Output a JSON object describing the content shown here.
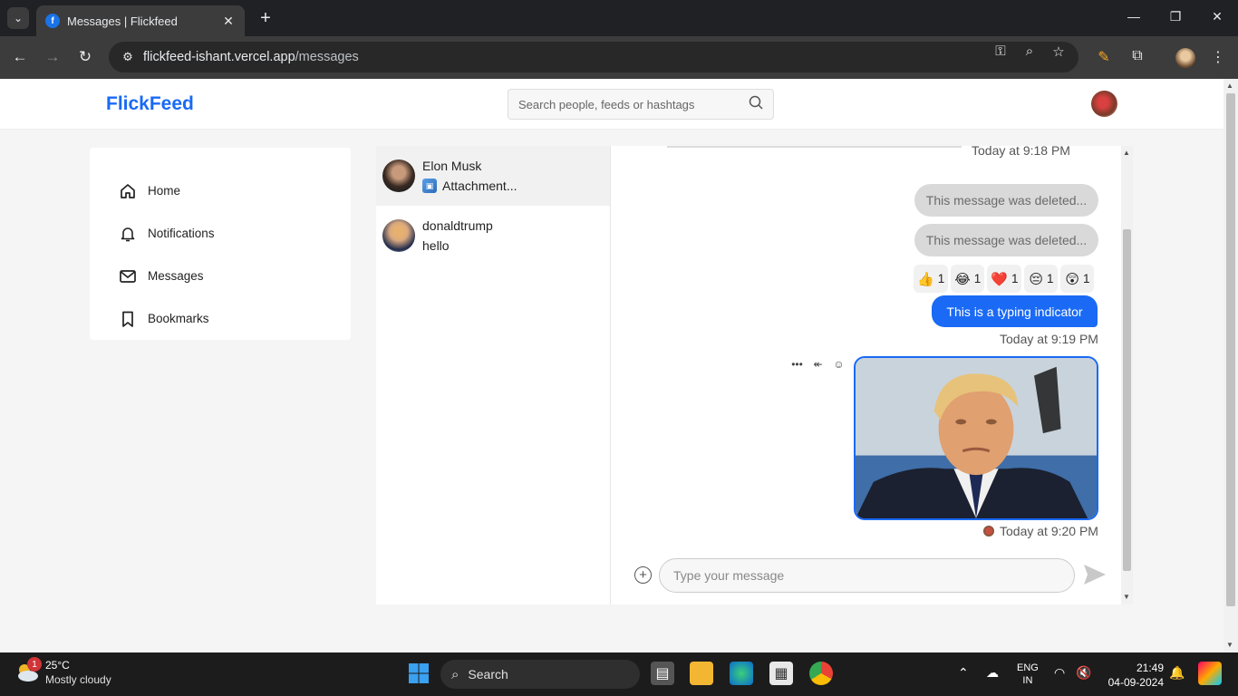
{
  "browser": {
    "tab_title": "Messages | Flickfeed",
    "favicon_letter": "f",
    "url_domain": "flickfeed-ishant.vercel.app",
    "url_path": "/messages"
  },
  "app": {
    "logo": "FlickFeed",
    "search_placeholder": "Search people, feeds or hashtags",
    "brand_color": "#1a6af5"
  },
  "sidebar": {
    "items": [
      {
        "label": "Home",
        "icon": "home-icon"
      },
      {
        "label": "Notifications",
        "icon": "bell-icon"
      },
      {
        "label": "Messages",
        "icon": "mail-icon"
      },
      {
        "label": "Bookmarks",
        "icon": "bookmark-icon"
      }
    ]
  },
  "conversations": [
    {
      "name": "Elon Musk",
      "preview": "Attachment...",
      "active": true
    },
    {
      "name": "donaldtrump",
      "preview": "hello",
      "active": false
    }
  ],
  "chat": {
    "top_timestamp": "Today at 9:18 PM",
    "deleted_1": "This message was deleted...",
    "deleted_2": "This message was deleted...",
    "reactions": [
      {
        "emoji": "👍",
        "count": "1"
      },
      {
        "emoji": "😂",
        "count": "1"
      },
      {
        "emoji": "❤️",
        "count": "1"
      },
      {
        "emoji": "😔",
        "count": "1"
      },
      {
        "emoji": "😲",
        "count": "1"
      }
    ],
    "typing_message": "This is a typing indicator",
    "typing_timestamp": "Today at 9:19 PM",
    "image_timestamp": "Today at 9:20 PM",
    "compose_placeholder": "Type your message"
  },
  "taskbar": {
    "weather_temp": "25°C",
    "weather_desc": "Mostly cloudy",
    "weather_badge": "1",
    "search_label": "Search",
    "lang_1": "ENG",
    "lang_2": "IN",
    "time": "21:49",
    "date": "04-09-2024"
  }
}
